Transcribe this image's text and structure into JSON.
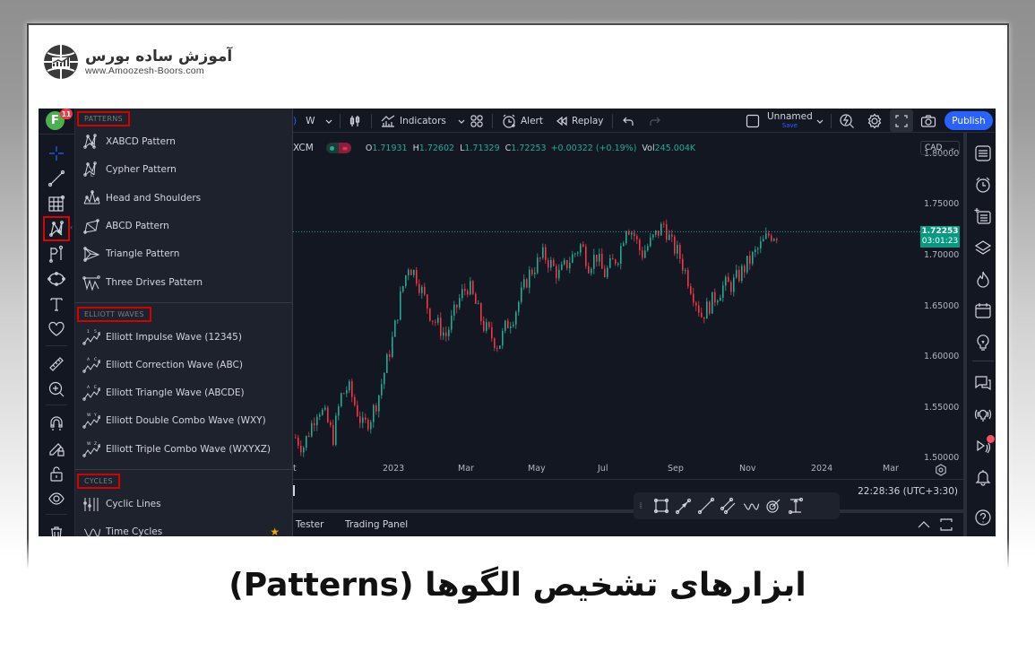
{
  "logo": {
    "persian_name": "آموزش ساده بورس",
    "url_text": "www.Amoozesh-Boors.com"
  },
  "user": {
    "avatar_letter": "F",
    "notification_count": "11"
  },
  "toolbar": {
    "interval": "W",
    "indicators_label": "Indicators",
    "alert_label": "Alert",
    "replay_label": "Replay",
    "layout_name": "Unnamed",
    "layout_save": "Save",
    "publish_label": "Publish"
  },
  "legend": {
    "symbol": "XCM",
    "open_key": "O",
    "open": "1.71931",
    "high_key": "H",
    "high": "1.72602",
    "low_key": "L",
    "low": "1.71329",
    "close_key": "C",
    "close": "1.72253",
    "change": "+0.00322 (+0.19%)",
    "vol_key": "Vol",
    "vol": "245.004K"
  },
  "colors": {
    "up": "#22ab94",
    "down": "#f23645",
    "accent": "#2962ff",
    "highlight_box": "#d50000"
  },
  "menu": {
    "sections": [
      {
        "header": "PATTERNS",
        "items": [
          {
            "label": "XABCD Pattern",
            "icon": "xabcd-pattern-icon"
          },
          {
            "label": "Cypher Pattern",
            "icon": "cypher-pattern-icon"
          },
          {
            "label": "Head and Shoulders",
            "icon": "head-shoulders-icon"
          },
          {
            "label": "ABCD Pattern",
            "icon": "abcd-pattern-icon"
          },
          {
            "label": "Triangle Pattern",
            "icon": "triangle-pattern-icon"
          },
          {
            "label": "Three Drives Pattern",
            "icon": "three-drives-icon"
          }
        ]
      },
      {
        "header": "ELLIOTT WAVES",
        "items": [
          {
            "label": "Elliott Impulse Wave (12345)",
            "icon": "elliott-impulse-icon",
            "tag": "1 5"
          },
          {
            "label": "Elliott Correction Wave (ABC)",
            "icon": "elliott-correction-icon",
            "tag": "A C"
          },
          {
            "label": "Elliott Triangle Wave (ABCDE)",
            "icon": "elliott-triangle-icon",
            "tag": "A E"
          },
          {
            "label": "Elliott Double Combo Wave (WXY)",
            "icon": "elliott-double-combo-icon",
            "tag": "W Y"
          },
          {
            "label": "Elliott Triple Combo Wave (WXYXZ)",
            "icon": "elliott-triple-combo-icon",
            "tag": "W Z"
          }
        ]
      },
      {
        "header": "CYCLES",
        "items": [
          {
            "label": "Cyclic Lines",
            "icon": "cyclic-lines-icon"
          },
          {
            "label": "Time Cycles",
            "icon": "time-cycles-icon",
            "favorite": true
          }
        ]
      }
    ]
  },
  "price_axis": {
    "currency": "CAD",
    "labels": [
      "1.80000",
      "1.75000",
      "1.70000",
      "1.65000",
      "1.60000",
      "1.55000",
      "1.50000"
    ],
    "last_price": "1.72253",
    "countdown": "03:01:23"
  },
  "time_axis": {
    "labels": [
      "t",
      "2023",
      "Mar",
      "May",
      "Jul",
      "Sep",
      "Nov",
      "2024",
      "Mar"
    ]
  },
  "status": {
    "clock": "22:28:36 (UTC+3:30)"
  },
  "bottom_tabs": [
    "Tester",
    "Trading Panel"
  ],
  "chart_data": {
    "type": "candlestick",
    "symbol": "XCM",
    "currency": "CAD",
    "ylim": [
      1.48,
      1.82
    ],
    "last_price": 1.72253,
    "y_ticks": [
      1.8,
      1.75,
      1.7,
      1.65,
      1.6,
      1.55,
      1.5
    ],
    "x_ticks": [
      "2023",
      "Mar",
      "May",
      "Jul",
      "Sep",
      "Nov",
      "2024",
      "Mar"
    ],
    "close_path": [
      1.52,
      1.51,
      1.53,
      1.55,
      1.54,
      1.52,
      1.56,
      1.57,
      1.55,
      1.53,
      1.54,
      1.56,
      1.59,
      1.62,
      1.66,
      1.69,
      1.68,
      1.66,
      1.64,
      1.63,
      1.62,
      1.64,
      1.66,
      1.67,
      1.65,
      1.63,
      1.62,
      1.61,
      1.63,
      1.64,
      1.66,
      1.68,
      1.69,
      1.7,
      1.69,
      1.68,
      1.69,
      1.7,
      1.71,
      1.69,
      1.7,
      1.68,
      1.69,
      1.7,
      1.73,
      1.72,
      1.7,
      1.71,
      1.72,
      1.73,
      1.71,
      1.7,
      1.68,
      1.66,
      1.64,
      1.65,
      1.66,
      1.67,
      1.67,
      1.68,
      1.69,
      1.7,
      1.71,
      1.72,
      1.72
    ]
  },
  "title": "ابزارهای تشخیص الگوها (Patterns)"
}
